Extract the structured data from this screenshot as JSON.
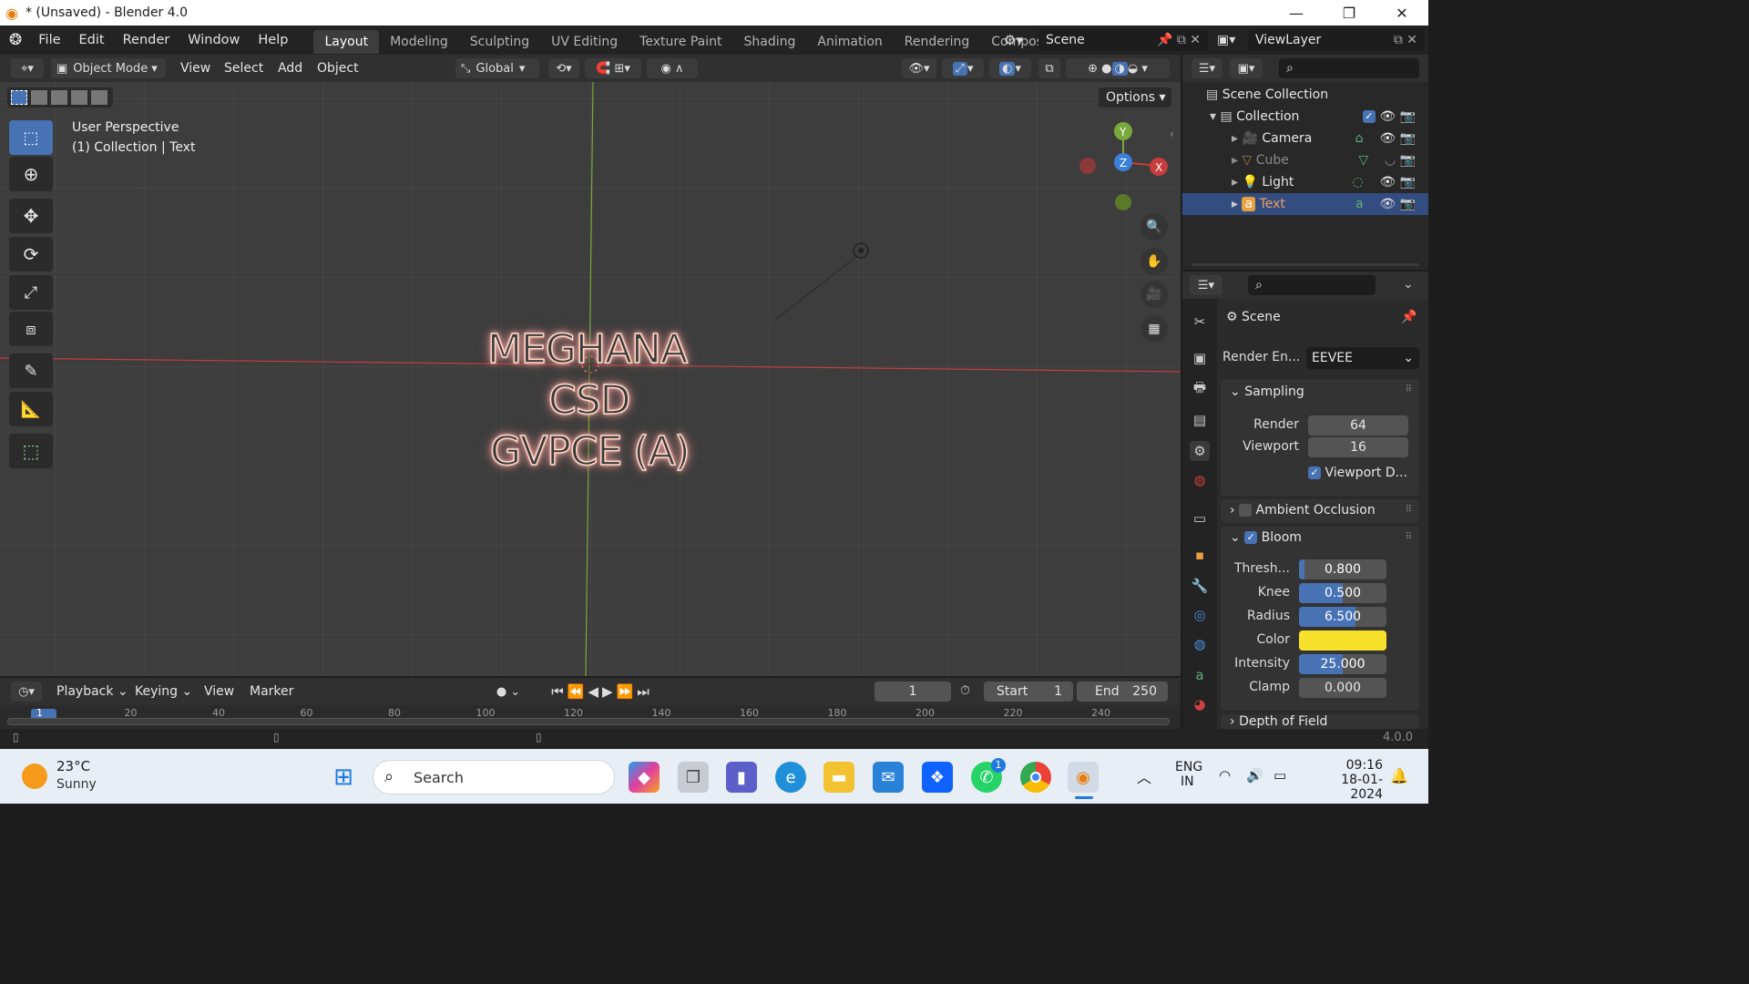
{
  "window": {
    "title": "* (Unsaved) - Blender 4.0",
    "minimize": "—",
    "maximize": "❐",
    "close": "✕"
  },
  "menu": {
    "items": [
      "File",
      "Edit",
      "Render",
      "Window",
      "Help"
    ]
  },
  "workspaces": {
    "tabs": [
      "Layout",
      "Modeling",
      "Sculpting",
      "UV Editing",
      "Texture Paint",
      "Shading",
      "Animation",
      "Rendering",
      "Compositin"
    ],
    "active": "Layout"
  },
  "scene_field": "Scene",
  "viewlayer_field": "ViewLayer",
  "viewport_header": {
    "mode": "Object Mode",
    "menus": [
      "View",
      "Select",
      "Add",
      "Object"
    ],
    "orientation": "Global",
    "options": "Options"
  },
  "viewport": {
    "perspective": "User Perspective",
    "collection_info": "(1) Collection | Text",
    "text_lines": [
      "MEGHANA",
      "CSD",
      "GVPCE (A)"
    ],
    "gizmo": {
      "y": "Y",
      "z": "Z",
      "x": "X"
    },
    "colors": {
      "bg": "#3d3d3d",
      "x_axis": "#c83c3c",
      "y_axis": "#7aa83a",
      "glow": "#f2a8a0"
    }
  },
  "outliner": {
    "root": "Scene Collection",
    "collection": "Collection",
    "items": [
      {
        "name": "Camera",
        "dim": false
      },
      {
        "name": "Cube",
        "dim": true
      },
      {
        "name": "Light",
        "dim": false
      },
      {
        "name": "Text",
        "dim": false,
        "selected": true
      }
    ]
  },
  "properties": {
    "title": "Scene",
    "render_engine_label": "Render En...",
    "render_engine": "EEVEE",
    "sampling": {
      "label": "Sampling",
      "render_label": "Render",
      "render": "64",
      "viewport_label": "Viewport",
      "viewport": "16",
      "denoise_label": "Viewport D..."
    },
    "ambient_occlusion": "Ambient Occlusion",
    "bloom": {
      "label": "Bloom",
      "threshold_label": "Thresh...",
      "threshold": "0.800",
      "knee_label": "Knee",
      "knee": "0.500",
      "radius_label": "Radius",
      "radius": "6.500",
      "color_label": "Color",
      "color": "#f7e12a",
      "intensity_label": "Intensity",
      "intensity": "25.000",
      "clamp_label": "Clamp",
      "clamp": "0.000"
    },
    "depth_of_field": "Depth of Field"
  },
  "timeline": {
    "menus": [
      "Playback",
      "Keying",
      "View",
      "Marker"
    ],
    "current_frame": "1",
    "start_label": "Start",
    "start": "1",
    "end_label": "End",
    "end": "250",
    "ruler_marks": [
      "1",
      "20",
      "40",
      "60",
      "80",
      "100",
      "120",
      "140",
      "160",
      "180",
      "200",
      "220",
      "240"
    ]
  },
  "status": {
    "version": "4.0.0"
  },
  "taskbar": {
    "weather_temp": "23°C",
    "weather_desc": "Sunny",
    "search_placeholder": "Search",
    "lang_top": "ENG",
    "lang_bottom": "IN",
    "time": "09:16",
    "date": "18-01-2024",
    "whatsapp_badge": "1"
  }
}
